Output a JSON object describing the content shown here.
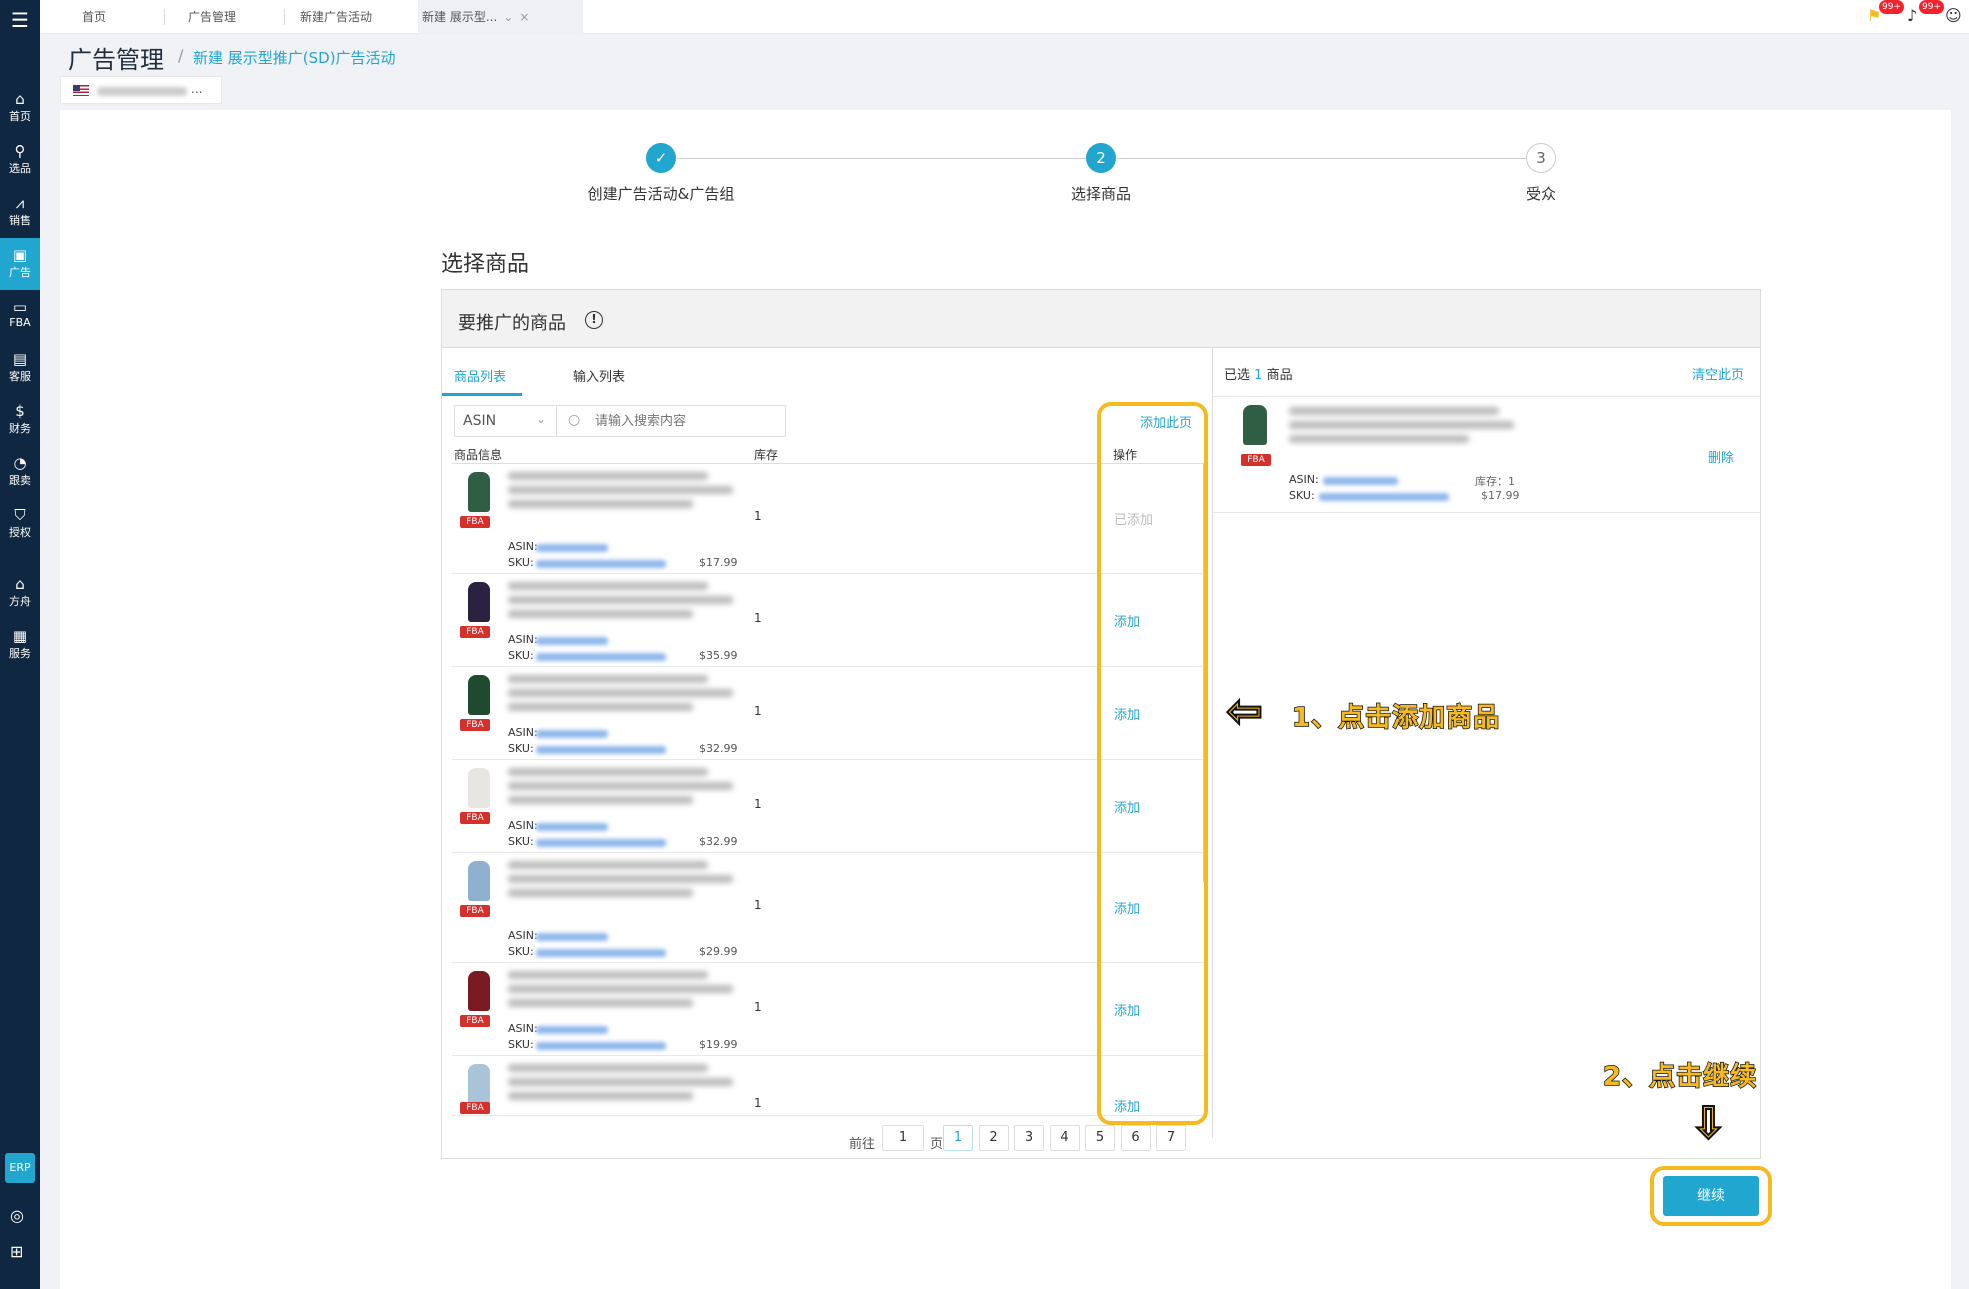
{
  "sidebar": {
    "items": [
      {
        "label": "首页",
        "icon": "home-icon"
      },
      {
        "label": "选品",
        "icon": "search-icon"
      },
      {
        "label": "销售",
        "icon": "chart-icon"
      },
      {
        "label": "广告",
        "icon": "ad-icon"
      },
      {
        "label": "FBA",
        "icon": "fba-icon"
      },
      {
        "label": "客服",
        "icon": "service-icon"
      },
      {
        "label": "财务",
        "icon": "finance-icon"
      },
      {
        "label": "跟卖",
        "icon": "follow-sell-icon"
      },
      {
        "label": "授权",
        "icon": "shield-icon"
      },
      {
        "label": "方舟",
        "icon": "ark-icon"
      },
      {
        "label": "服务",
        "icon": "services-icon"
      }
    ],
    "erp_label": "ERP"
  },
  "topbar": {
    "tabs": [
      "首页",
      "广告管理",
      "新建广告活动",
      "新建 展示型..."
    ],
    "badges": [
      "99+",
      "99+"
    ]
  },
  "breadcrumb": {
    "main": "广告管理",
    "separator": "/",
    "sub": "新建 展示型推广(SD)广告活动"
  },
  "store_selector": {
    "suffix": "..."
  },
  "steps": [
    {
      "number": "✓",
      "label": "创建广告活动&广告组",
      "state": "done"
    },
    {
      "number": "2",
      "label": "选择商品",
      "state": "current"
    },
    {
      "number": "3",
      "label": "受众",
      "state": "pending"
    }
  ],
  "section_title": "选择商品",
  "panel": {
    "title": "要推广的商品",
    "info_icon": "!",
    "subtabs": [
      "商品列表",
      "输入列表"
    ],
    "search": {
      "type": "ASIN",
      "placeholder": "请输入搜索内容"
    },
    "add_page": "添加此页",
    "columns": {
      "info": "商品信息",
      "stock": "库存",
      "op": "操作"
    }
  },
  "products": [
    {
      "asin_label": "ASIN:",
      "sku_label": "SKU:",
      "price": "$17.99",
      "stock": "1",
      "op": "已添加",
      "added": true,
      "color": "#2f5e45"
    },
    {
      "asin_label": "ASIN:",
      "sku_label": "SKU:",
      "price": "$35.99",
      "stock": "1",
      "op": "添加",
      "added": false,
      "color": "#2a2240"
    },
    {
      "asin_label": "ASIN:",
      "sku_label": "SKU:",
      "price": "$32.99",
      "stock": "1",
      "op": "添加",
      "added": false,
      "color": "#1e4a2f"
    },
    {
      "asin_label": "ASIN:",
      "sku_label": "SKU:",
      "price": "$32.99",
      "stock": "1",
      "op": "添加",
      "added": false,
      "color": "#e8e6e2"
    },
    {
      "asin_label": "ASIN:",
      "sku_label": "SKU:",
      "price": "$29.99",
      "stock": "1",
      "op": "添加",
      "added": false,
      "color": "#8fb1cf"
    },
    {
      "asin_label": "ASIN:",
      "sku_label": "SKU:",
      "price": "$19.99",
      "stock": "1",
      "op": "添加",
      "added": false,
      "color": "#7a1a22"
    },
    {
      "asin_label": "",
      "sku_label": "",
      "price": "",
      "stock": "1",
      "op": "添加",
      "added": false,
      "color": "#a9c3d9"
    }
  ],
  "fba_badge": "FBA",
  "pagination": {
    "prefix": "前往",
    "input": "1",
    "suffix": "页",
    "pages": [
      "1",
      "2",
      "3",
      "4",
      "5",
      "6",
      "7"
    ],
    "current": "1"
  },
  "selected": {
    "label_a": "已选",
    "count": "1",
    "label_b": "商品",
    "clear": "清空此页",
    "item": {
      "asin_label": "ASIN:",
      "sku_label": "SKU:",
      "stock_label": "库存：1",
      "price": "$17.99",
      "delete": "删除",
      "color": "#2f5e45"
    }
  },
  "continue_button": "继续",
  "annotations": {
    "step1": "1、点击添加商品",
    "step2": "2、点击继续"
  },
  "colors": {
    "accent": "#21a6cf",
    "sidebar": "#0f2740",
    "highlight": "#f6b91f",
    "fba": "#d4302c"
  }
}
